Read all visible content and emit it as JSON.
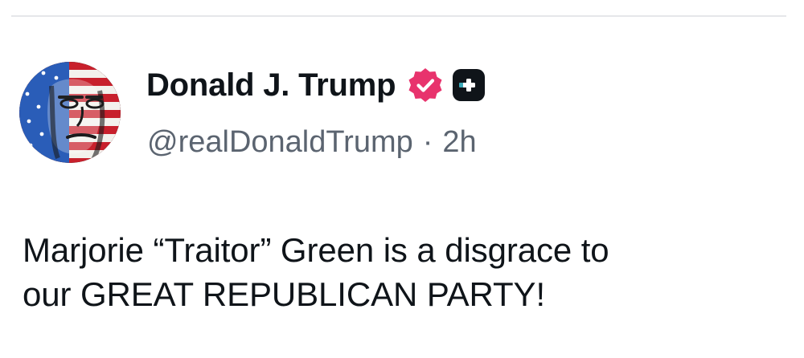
{
  "post": {
    "author": {
      "display_name": "Donald J. Trump",
      "handle": "@realDonaldTrump",
      "verified_icon": "verified-badge-icon",
      "verified_color": "#e8336d",
      "platform_icon": "plus-app-icon"
    },
    "separator": "·",
    "time_ago": "2h",
    "text_lines": [
      "Marjorie “Traitor” Green is a disgrace to",
      "our GREAT REPUBLICAN PARTY!"
    ]
  }
}
